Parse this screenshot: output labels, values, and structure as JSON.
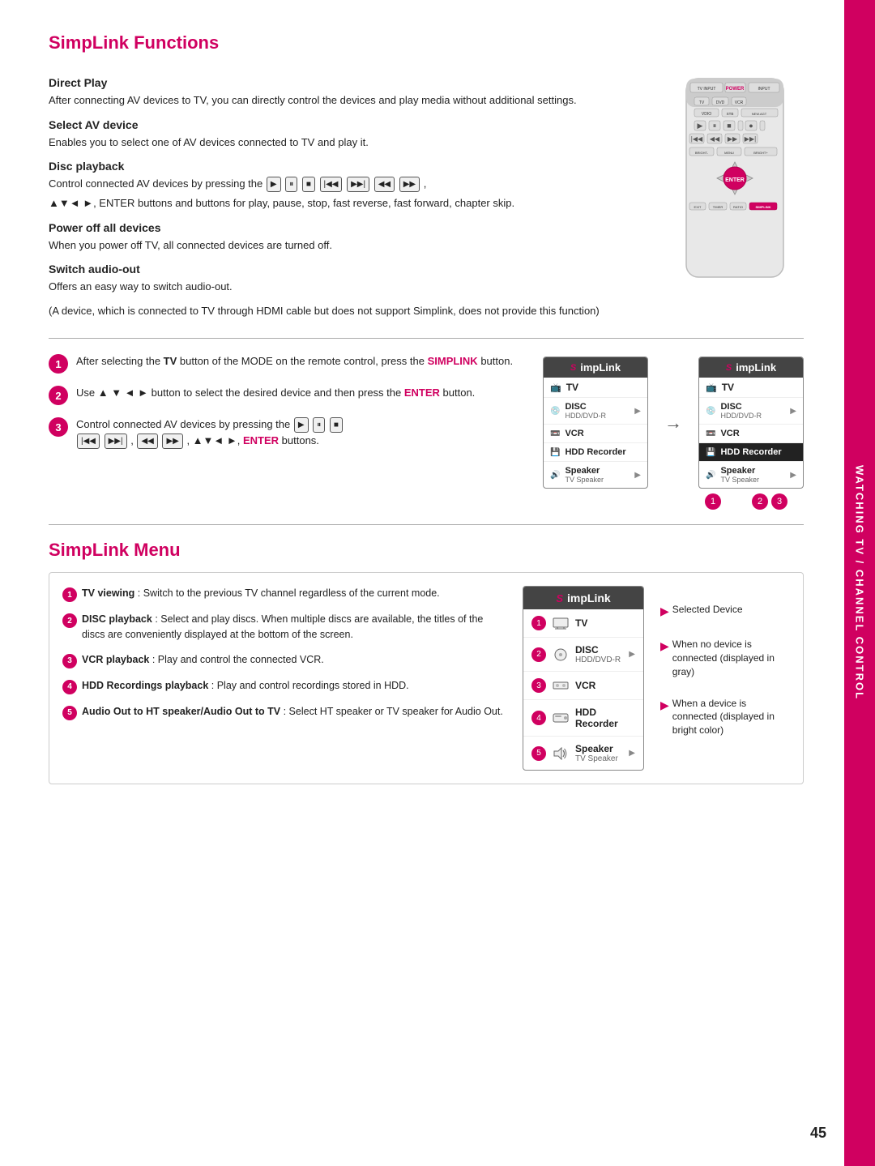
{
  "page": {
    "number": "45",
    "side_tab": "WATCHING TV / CHANNEL CONTROL"
  },
  "simplink_functions": {
    "title": "SimpLink Functions",
    "sections": [
      {
        "id": "direct_play",
        "title": "Direct Play",
        "text": "After connecting AV devices to TV, you can directly control the devices and play media without additional settings."
      },
      {
        "id": "select_av",
        "title": "Select AV device",
        "text": "Enables you to select one of AV devices connected to TV and play it."
      },
      {
        "id": "disc_playback",
        "title": "Disc playback",
        "text": "Control connected AV devices by pressing the",
        "text2": "▲▼◄ ►, ENTER buttons and buttons for play, pause, stop, fast reverse, fast forward, chapter skip."
      },
      {
        "id": "power_off",
        "title": "Power off all devices",
        "text": "When you power off TV, all connected devices are turned off."
      },
      {
        "id": "switch_audio",
        "title": "Switch audio-out",
        "text": "Offers an easy way to switch audio-out."
      },
      {
        "id": "note",
        "text": "(A device, which is connected to TV through HDMI cable but does not support Simplink, does not provide this function)"
      }
    ],
    "steps": [
      {
        "num": "1",
        "text": "After selecting the TV button of the MODE on the remote control, press the SIMPLINK button."
      },
      {
        "num": "2",
        "text": "Use ▲ ▼ ◄ ► button to select the desired device and then press the ENTER button."
      },
      {
        "num": "3",
        "text": "Control connected AV devices by pressing the  ,  ,  ,  ,  ,  ,  , ▲▼◄ ►, ENTER buttons."
      }
    ],
    "panel1": {
      "header": "SIMPLINK",
      "items": [
        {
          "id": "tv",
          "label": "TV",
          "selected": false,
          "has_arrow": false
        },
        {
          "id": "disc",
          "label": "DISC",
          "sublabel": "HDD/DVD-R",
          "selected": false,
          "has_arrow": true
        },
        {
          "id": "vcr",
          "label": "VCR",
          "selected": false,
          "has_arrow": false
        },
        {
          "id": "hdd",
          "label": "HDD Recorder",
          "selected": false,
          "has_arrow": false
        },
        {
          "id": "speaker",
          "label": "Speaker",
          "sublabel": "TV Speaker",
          "selected": false,
          "has_arrow": true
        }
      ]
    },
    "panel2": {
      "header": "SIMPLINK",
      "items": [
        {
          "id": "tv",
          "label": "TV",
          "selected": false,
          "has_arrow": false
        },
        {
          "id": "disc",
          "label": "DISC",
          "sublabel": "HDD/DVD-R",
          "selected": false,
          "has_arrow": true
        },
        {
          "id": "vcr",
          "label": "VCR",
          "selected": false,
          "has_arrow": false
        },
        {
          "id": "hdd",
          "label": "HDD Recorder",
          "selected": true,
          "has_arrow": false
        },
        {
          "id": "speaker",
          "label": "Speaker",
          "sublabel": "TV Speaker",
          "selected": false,
          "has_arrow": true
        }
      ]
    },
    "step_nums": [
      "1",
      "2 3"
    ]
  },
  "simplink_menu": {
    "title": "SimpLink Menu",
    "items": [
      {
        "num": "1",
        "title": "TV viewing",
        "text": ": Switch to the previous TV channel regardless of the current mode."
      },
      {
        "num": "2",
        "title": "DISC playback",
        "text": ": Select and play discs. When multiple discs are available, the titles of the discs are conveniently displayed at the bottom of the screen."
      },
      {
        "num": "3",
        "title": "VCR playback",
        "text": ": Play and control the connected VCR."
      },
      {
        "num": "4",
        "title": "HDD Recordings playback",
        "text": ": Play and control recordings stored in HDD."
      },
      {
        "num": "5",
        "title": "Audio Out to HT speaker/Audio Out to TV",
        "text": ": Select HT speaker or TV speaker for Audio Out."
      }
    ],
    "big_panel": {
      "header": "SIMPLINK",
      "items": [
        {
          "id": "tv",
          "num": "1",
          "label": "TV",
          "selected": false
        },
        {
          "id": "disc",
          "num": "2",
          "label": "DISC",
          "sublabel": "HDD/DVD-R",
          "selected": false,
          "has_arrow": true
        },
        {
          "id": "vcr",
          "num": "3",
          "label": "VCR",
          "selected": false
        },
        {
          "id": "hdd",
          "num": "4",
          "label": "HDD Recorder",
          "selected": false
        },
        {
          "id": "speaker",
          "num": "5",
          "label": "Speaker",
          "sublabel": "TV Speaker",
          "selected": false,
          "has_arrow": true
        }
      ]
    },
    "annotations": [
      {
        "text": "Selected  Device"
      },
      {
        "text": "When no device is connected (displayed in gray)"
      },
      {
        "text": "When a device is connected (displayed in bright color)"
      }
    ]
  }
}
